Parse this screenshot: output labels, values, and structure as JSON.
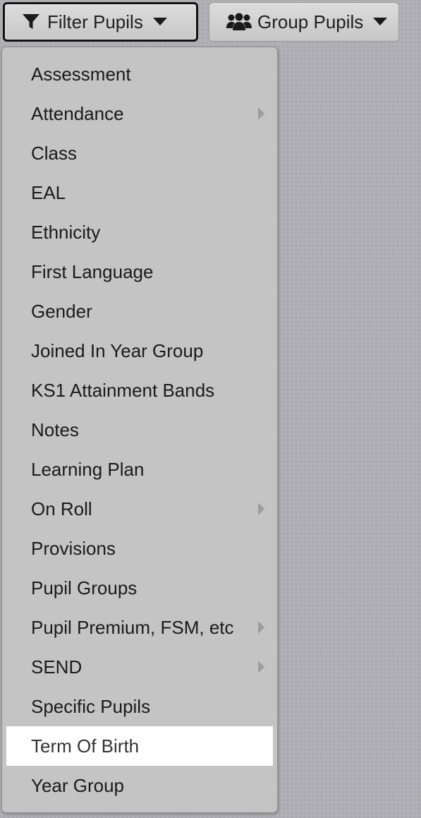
{
  "toolbar": {
    "filter_label": "Filter Pupils",
    "group_label": "Group Pupils"
  },
  "menu": {
    "items": [
      {
        "label": "Assessment",
        "has_submenu": false
      },
      {
        "label": "Attendance",
        "has_submenu": true
      },
      {
        "label": "Class",
        "has_submenu": false
      },
      {
        "label": "EAL",
        "has_submenu": false
      },
      {
        "label": "Ethnicity",
        "has_submenu": false
      },
      {
        "label": "First Language",
        "has_submenu": false
      },
      {
        "label": "Gender",
        "has_submenu": false
      },
      {
        "label": "Joined In Year Group",
        "has_submenu": false
      },
      {
        "label": "KS1 Attainment Bands",
        "has_submenu": false
      },
      {
        "label": "Notes",
        "has_submenu": false
      },
      {
        "label": "Learning Plan",
        "has_submenu": false
      },
      {
        "label": "On Roll",
        "has_submenu": true
      },
      {
        "label": "Provisions",
        "has_submenu": false
      },
      {
        "label": "Pupil Groups",
        "has_submenu": false
      },
      {
        "label": "Pupil Premium, FSM, etc",
        "has_submenu": true
      },
      {
        "label": "SEND",
        "has_submenu": true
      },
      {
        "label": "Specific Pupils",
        "has_submenu": false
      },
      {
        "label": "Term Of Birth",
        "has_submenu": false,
        "selected": true
      },
      {
        "label": "Year Group",
        "has_submenu": false
      }
    ]
  },
  "icons": {
    "filter": "funnel-icon",
    "group": "users-icon",
    "caret": "caret-down-icon",
    "submenu": "chevron-right-icon"
  }
}
